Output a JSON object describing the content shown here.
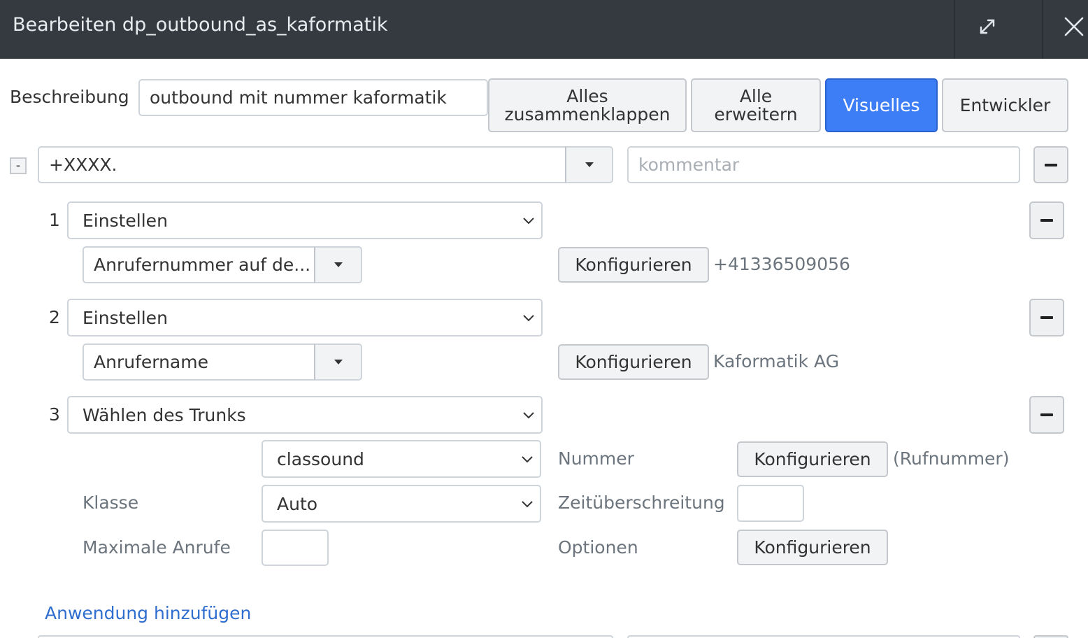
{
  "dialog": {
    "title": "Bearbeiten dp_outbound_as_kaformatik",
    "colors": {
      "titlebar": "#343a40",
      "primary": "#3d7ef7",
      "link": "#2f6ecf"
    }
  },
  "toolbar": {
    "description_label": "Beschreibung",
    "description_value": "outbound mit nummer kaformatik",
    "collapse_all_line1": "Alles",
    "collapse_all_line2": "zusammenklappen",
    "expand_all_line1": "Alle",
    "expand_all_line2": "erweitern",
    "visual_label": "Visuelles",
    "developer_label": "Entwickler"
  },
  "extension": {
    "collapse_symbol": "-",
    "pattern_value": "+XXXX.",
    "comment_placeholder": "kommentar"
  },
  "steps": [
    {
      "number": "1",
      "action": "Einstellen",
      "sub_value": "Anrufernummer auf de...",
      "configure_label": "Konfigurieren",
      "config_value": "+41336509056"
    },
    {
      "number": "2",
      "action": "Einstellen",
      "sub_value": "Anrufername",
      "configure_label": "Konfigurieren",
      "config_value": "Kaformatik AG"
    },
    {
      "number": "3",
      "action": "Wählen des Trunks",
      "trunk_value": "classound",
      "number_label": "Nummer",
      "number_configure_label": "Konfigurieren",
      "number_value": "(Rufnummer)",
      "class_label": "Klasse",
      "class_value": "Auto",
      "timeout_label": "Zeitüberschreitung",
      "timeout_value": "",
      "max_calls_label": "Maximale Anrufe",
      "max_calls_value": "",
      "options_label": "Optionen",
      "options_configure_label": "Konfigurieren"
    }
  ],
  "footer": {
    "add_application_label": "Anwendung hinzufügen"
  }
}
